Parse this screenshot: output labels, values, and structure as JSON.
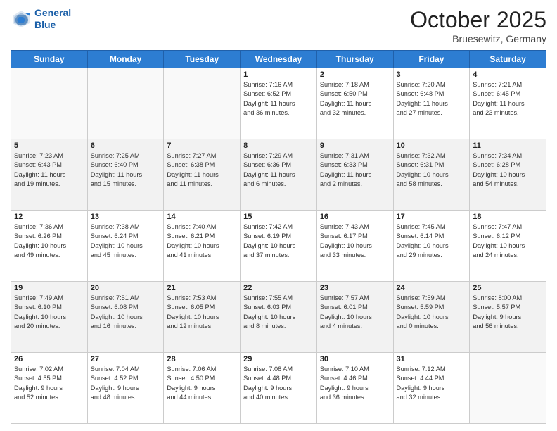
{
  "header": {
    "logo_line1": "General",
    "logo_line2": "Blue",
    "month": "October 2025",
    "location": "Bruesewitz, Germany"
  },
  "days_of_week": [
    "Sunday",
    "Monday",
    "Tuesday",
    "Wednesday",
    "Thursday",
    "Friday",
    "Saturday"
  ],
  "weeks": [
    [
      {
        "day": "",
        "info": ""
      },
      {
        "day": "",
        "info": ""
      },
      {
        "day": "",
        "info": ""
      },
      {
        "day": "1",
        "info": "Sunrise: 7:16 AM\nSunset: 6:52 PM\nDaylight: 11 hours\nand 36 minutes."
      },
      {
        "day": "2",
        "info": "Sunrise: 7:18 AM\nSunset: 6:50 PM\nDaylight: 11 hours\nand 32 minutes."
      },
      {
        "day": "3",
        "info": "Sunrise: 7:20 AM\nSunset: 6:48 PM\nDaylight: 11 hours\nand 27 minutes."
      },
      {
        "day": "4",
        "info": "Sunrise: 7:21 AM\nSunset: 6:45 PM\nDaylight: 11 hours\nand 23 minutes."
      }
    ],
    [
      {
        "day": "5",
        "info": "Sunrise: 7:23 AM\nSunset: 6:43 PM\nDaylight: 11 hours\nand 19 minutes."
      },
      {
        "day": "6",
        "info": "Sunrise: 7:25 AM\nSunset: 6:40 PM\nDaylight: 11 hours\nand 15 minutes."
      },
      {
        "day": "7",
        "info": "Sunrise: 7:27 AM\nSunset: 6:38 PM\nDaylight: 11 hours\nand 11 minutes."
      },
      {
        "day": "8",
        "info": "Sunrise: 7:29 AM\nSunset: 6:36 PM\nDaylight: 11 hours\nand 6 minutes."
      },
      {
        "day": "9",
        "info": "Sunrise: 7:31 AM\nSunset: 6:33 PM\nDaylight: 11 hours\nand 2 minutes."
      },
      {
        "day": "10",
        "info": "Sunrise: 7:32 AM\nSunset: 6:31 PM\nDaylight: 10 hours\nand 58 minutes."
      },
      {
        "day": "11",
        "info": "Sunrise: 7:34 AM\nSunset: 6:28 PM\nDaylight: 10 hours\nand 54 minutes."
      }
    ],
    [
      {
        "day": "12",
        "info": "Sunrise: 7:36 AM\nSunset: 6:26 PM\nDaylight: 10 hours\nand 49 minutes."
      },
      {
        "day": "13",
        "info": "Sunrise: 7:38 AM\nSunset: 6:24 PM\nDaylight: 10 hours\nand 45 minutes."
      },
      {
        "day": "14",
        "info": "Sunrise: 7:40 AM\nSunset: 6:21 PM\nDaylight: 10 hours\nand 41 minutes."
      },
      {
        "day": "15",
        "info": "Sunrise: 7:42 AM\nSunset: 6:19 PM\nDaylight: 10 hours\nand 37 minutes."
      },
      {
        "day": "16",
        "info": "Sunrise: 7:43 AM\nSunset: 6:17 PM\nDaylight: 10 hours\nand 33 minutes."
      },
      {
        "day": "17",
        "info": "Sunrise: 7:45 AM\nSunset: 6:14 PM\nDaylight: 10 hours\nand 29 minutes."
      },
      {
        "day": "18",
        "info": "Sunrise: 7:47 AM\nSunset: 6:12 PM\nDaylight: 10 hours\nand 24 minutes."
      }
    ],
    [
      {
        "day": "19",
        "info": "Sunrise: 7:49 AM\nSunset: 6:10 PM\nDaylight: 10 hours\nand 20 minutes."
      },
      {
        "day": "20",
        "info": "Sunrise: 7:51 AM\nSunset: 6:08 PM\nDaylight: 10 hours\nand 16 minutes."
      },
      {
        "day": "21",
        "info": "Sunrise: 7:53 AM\nSunset: 6:05 PM\nDaylight: 10 hours\nand 12 minutes."
      },
      {
        "day": "22",
        "info": "Sunrise: 7:55 AM\nSunset: 6:03 PM\nDaylight: 10 hours\nand 8 minutes."
      },
      {
        "day": "23",
        "info": "Sunrise: 7:57 AM\nSunset: 6:01 PM\nDaylight: 10 hours\nand 4 minutes."
      },
      {
        "day": "24",
        "info": "Sunrise: 7:59 AM\nSunset: 5:59 PM\nDaylight: 10 hours\nand 0 minutes."
      },
      {
        "day": "25",
        "info": "Sunrise: 8:00 AM\nSunset: 5:57 PM\nDaylight: 9 hours\nand 56 minutes."
      }
    ],
    [
      {
        "day": "26",
        "info": "Sunrise: 7:02 AM\nSunset: 4:55 PM\nDaylight: 9 hours\nand 52 minutes."
      },
      {
        "day": "27",
        "info": "Sunrise: 7:04 AM\nSunset: 4:52 PM\nDaylight: 9 hours\nand 48 minutes."
      },
      {
        "day": "28",
        "info": "Sunrise: 7:06 AM\nSunset: 4:50 PM\nDaylight: 9 hours\nand 44 minutes."
      },
      {
        "day": "29",
        "info": "Sunrise: 7:08 AM\nSunset: 4:48 PM\nDaylight: 9 hours\nand 40 minutes."
      },
      {
        "day": "30",
        "info": "Sunrise: 7:10 AM\nSunset: 4:46 PM\nDaylight: 9 hours\nand 36 minutes."
      },
      {
        "day": "31",
        "info": "Sunrise: 7:12 AM\nSunset: 4:44 PM\nDaylight: 9 hours\nand 32 minutes."
      },
      {
        "day": "",
        "info": ""
      }
    ]
  ]
}
